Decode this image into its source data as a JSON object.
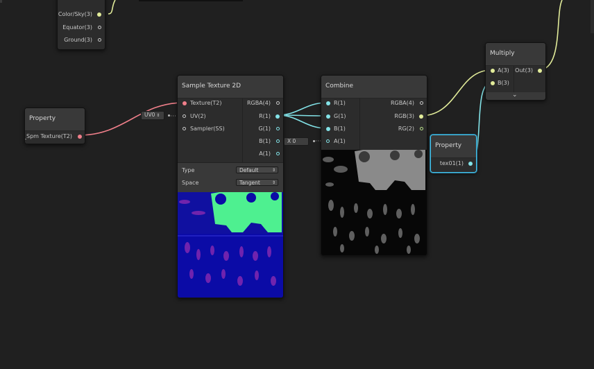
{
  "nodes": {
    "gradient": {
      "ports": [
        "Color/Sky(3)",
        "Equator(3)",
        "Ground(3)"
      ]
    },
    "property_left": {
      "title": "Property",
      "port": "_Spm Texture(T2)"
    },
    "sample": {
      "title": "Sample Texture 2D",
      "inputs": [
        "Texture(T2)",
        "UV(2)",
        "Sampler(SS)"
      ],
      "outputs": [
        "RGBA(4)",
        "R(1)",
        "G(1)",
        "B(1)",
        "A(1)"
      ],
      "type_label": "Type",
      "type_value": "Default",
      "space_label": "Space",
      "space_value": "Tangent",
      "uv_inline": "UV0"
    },
    "combine": {
      "title": "Combine",
      "inputs": [
        "R(1)",
        "G(1)",
        "B(1)",
        "A(1)"
      ],
      "outputs": [
        "RGBA(4)",
        "RGB(3)",
        "RG(2)"
      ],
      "a_inline": "X 0"
    },
    "multiply": {
      "title": "Multiply",
      "inputs": [
        "A(3)",
        "B(3)"
      ],
      "output": "Out(3)",
      "expand_icon": "chevron-down-icon"
    },
    "property_right": {
      "title": "Property",
      "port": "tex01(1)"
    }
  },
  "colors": {
    "background": "#202020",
    "node": "#393939",
    "texture_wire": "#f07f8a",
    "vector3_wire": "#e2ec9a",
    "float_wire": "#83e3e8",
    "selection": "#44c0e8"
  }
}
